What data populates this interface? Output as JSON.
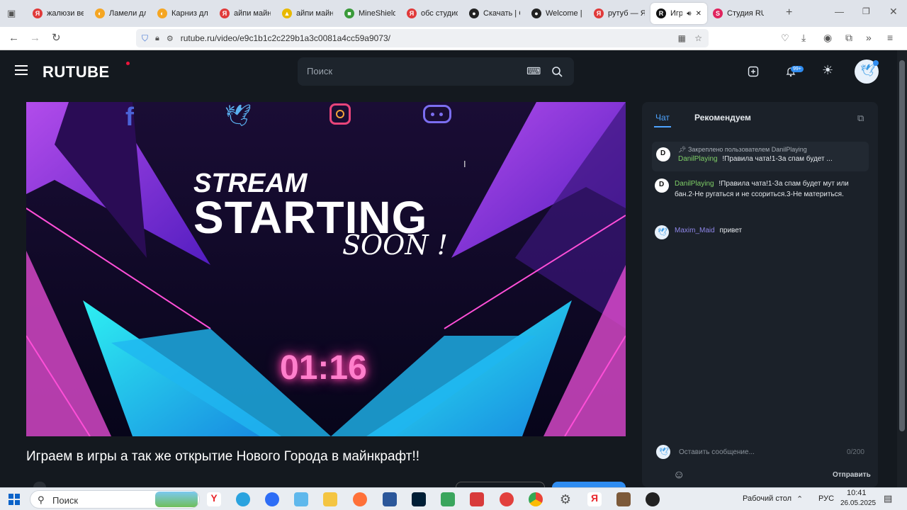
{
  "browser": {
    "tabs": [
      {
        "label": "жалюзи вер",
        "color": "#e03a3a",
        "glyph": "Я"
      },
      {
        "label": "Ламели для",
        "color": "#f5a623",
        "glyph": "◐"
      },
      {
        "label": "Карниз для",
        "color": "#f5a623",
        "glyph": "◐"
      },
      {
        "label": "айпи майнк",
        "color": "#e03a3a",
        "glyph": "Я"
      },
      {
        "label": "айпи майнк",
        "color": "#e8b900",
        "glyph": "▲"
      },
      {
        "label": "MineShield",
        "color": "#3a9a3a",
        "glyph": "■"
      },
      {
        "label": "обс студио",
        "color": "#e03a3a",
        "glyph": "Я"
      },
      {
        "label": "Скачать | O",
        "color": "#222222",
        "glyph": "●"
      },
      {
        "label": "Welcome | O",
        "color": "#222222",
        "glyph": "●"
      },
      {
        "label": "рутуб — Ян",
        "color": "#e03a3a",
        "glyph": "Я"
      },
      {
        "label": "Игр",
        "color": "#111111",
        "glyph": "R",
        "active": true
      },
      {
        "label": "Студия RUT",
        "color": "#e0245e",
        "glyph": "S"
      }
    ],
    "url": "rutube.ru/video/e9c1b1c2c229b1a3c0081a4cc59a9073/"
  },
  "header": {
    "logo": "RUTUBE",
    "search_placeholder": "Поиск",
    "notif_badge": "99+"
  },
  "player": {
    "title_line1": "STREAM",
    "title_line2": "STARTING",
    "title_line3": "SOON !",
    "countdown": "01:16"
  },
  "video": {
    "title": "Играем в игры а так же открытие Нового Города в майнкрафт!!"
  },
  "chat": {
    "tab_chat": "Чат",
    "tab_recommend": "Рекомендуем",
    "pinned_label": "Закреплено пользователем DanilPlaying",
    "pinned_user": "DanilPlaying",
    "pinned_text": "!Правила чата!1-За спам будет ...",
    "messages": [
      {
        "user": "DanilPlaying",
        "text": "!Правила чата!1-За спам будет мут или бан.2-Не ругаться и не ссориться.3-Не материться."
      },
      {
        "user": "Maxim_Maid",
        "text": "привет"
      }
    ],
    "input_placeholder": "Оставить сообщение...",
    "counter": "0/200",
    "send": "Отправить"
  },
  "taskbar": {
    "search": "Поиск",
    "desktop": "Рабочий стол",
    "lang": "РУС",
    "time": "10:41",
    "date": "26.05.2025"
  },
  "colors": {
    "accent": "#2f8cf0",
    "chat_green": "#7fcf67",
    "neon_pink": "#ff4fb2"
  }
}
